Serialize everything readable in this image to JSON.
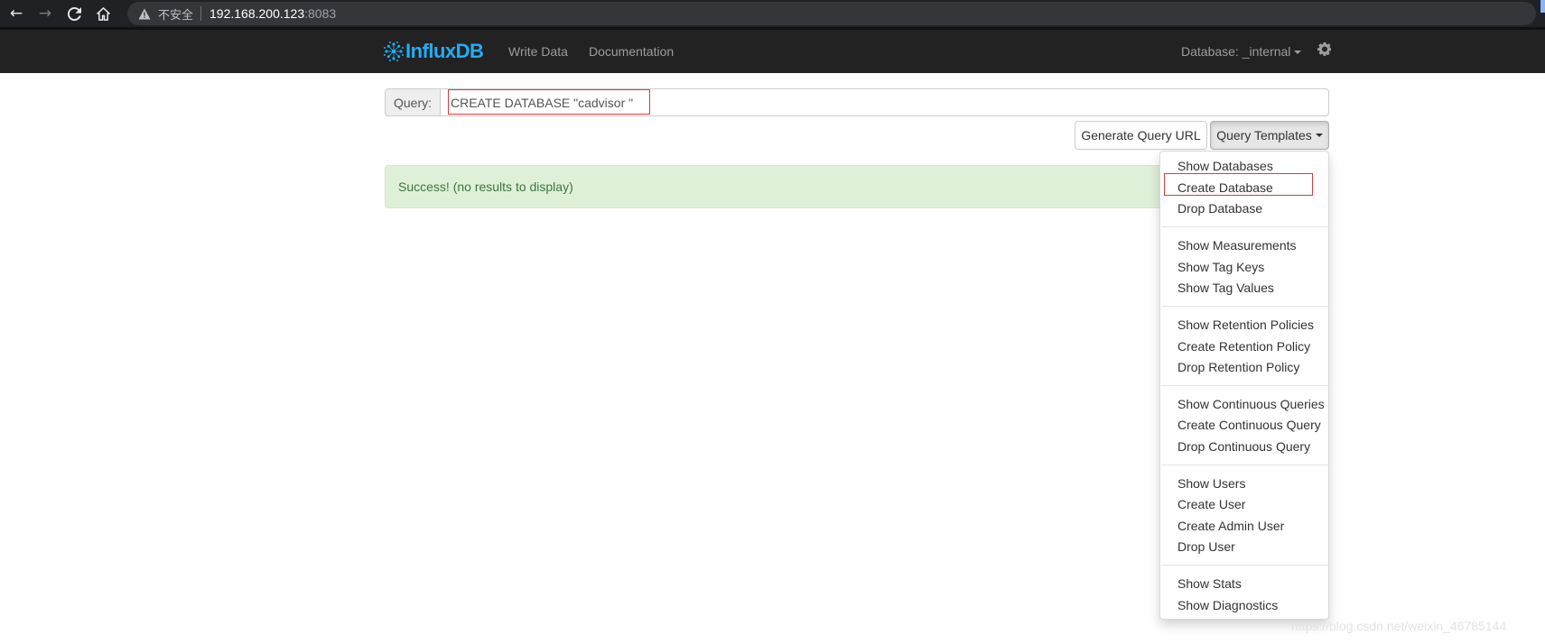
{
  "browser": {
    "security_label": "不安全",
    "url_host": "192.168.200.123",
    "url_port": ":8083"
  },
  "navbar": {
    "brand_influx": "Influx",
    "brand_db": "DB",
    "write_data": "Write Data",
    "documentation": "Documentation",
    "database_label": "Database: _internal"
  },
  "query": {
    "addon_label": "Query:",
    "value": "CREATE DATABASE \"cadvisor \""
  },
  "buttons": {
    "generate_url": "Generate Query URL",
    "templates": "Query Templates"
  },
  "alert": {
    "message": "Success! (no results to display)"
  },
  "templates_menu": [
    "Show Databases",
    "Create Database",
    "Drop Database",
    "Show Measurements",
    "Show Tag Keys",
    "Show Tag Values",
    "Show Retention Policies",
    "Create Retention Policy",
    "Drop Retention Policy",
    "Show Continuous Queries",
    "Create Continuous Query",
    "Drop Continuous Query",
    "Show Users",
    "Create User",
    "Create Admin User",
    "Drop User",
    "Show Stats",
    "Show Diagnostics"
  ],
  "watermark": "https://blog.csdn.net/weixin_46785144",
  "colors": {
    "navbar": "#222222",
    "brand": "#22adf6",
    "success_bg": "#dff0d8",
    "success_text": "#3c763d",
    "highlight": "#e53935"
  }
}
